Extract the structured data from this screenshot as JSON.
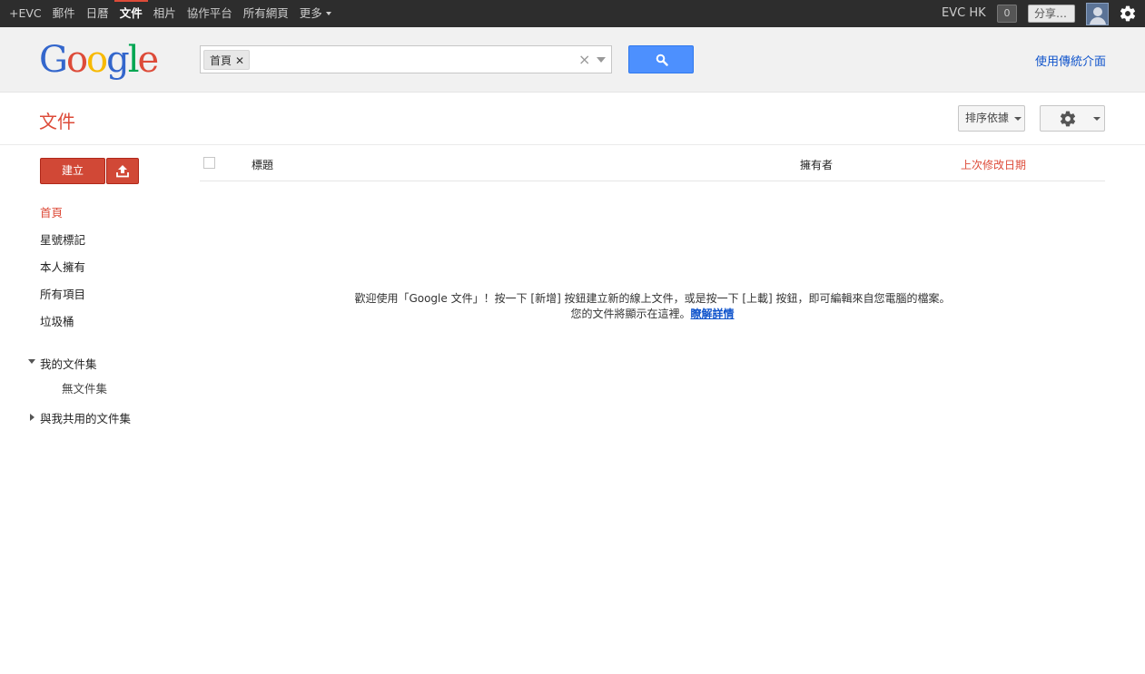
{
  "topbar": {
    "nav": [
      {
        "label": "+EVC",
        "active": false
      },
      {
        "label": "郵件",
        "active": false
      },
      {
        "label": "日曆",
        "active": false
      },
      {
        "label": "文件",
        "active": true
      },
      {
        "label": "相片",
        "active": false
      },
      {
        "label": "協作平台",
        "active": false
      },
      {
        "label": "所有網頁",
        "active": false
      },
      {
        "label": "更多",
        "active": false,
        "dropdown": true
      }
    ],
    "user_name": "EVC HK",
    "notification_count": "0",
    "share_label": "分享…"
  },
  "header": {
    "logo": [
      "G",
      "o",
      "o",
      "g",
      "l",
      "e"
    ],
    "logo_colors": [
      "#3366cc",
      "#dd4b39",
      "#f7b900",
      "#3366cc",
      "#00a652",
      "#dd4b39"
    ],
    "search_chip": "首頁",
    "search_clear": "×",
    "classic_link": "使用傳統介面"
  },
  "page": {
    "title": "文件",
    "sort_label": "排序依據"
  },
  "sidebar": {
    "create_label": "建立",
    "items": [
      {
        "label": "首頁",
        "active": true
      },
      {
        "label": "星號標記",
        "active": false
      },
      {
        "label": "本人擁有",
        "active": false
      },
      {
        "label": "所有項目",
        "active": false
      },
      {
        "label": "垃圾桶",
        "active": false
      }
    ],
    "my_collections": "我的文件集",
    "no_collections": "無文件集",
    "shared_collections": "與我共用的文件集"
  },
  "list": {
    "col_title": "標題",
    "col_owner": "擁有者",
    "col_date": "上次修改日期"
  },
  "empty": {
    "line1": "歡迎使用「Google 文件」！按一下 [新增] 按鈕建立新的線上文件，或是按一下 [上載] 按鈕，即可編輯來自您電腦的檔案。",
    "line2": "您的文件將顯示在這裡。",
    "learn_more": "瞭解詳情"
  },
  "colors": {
    "accent_red": "#dd4b39",
    "search_blue": "#4d90fe",
    "link_blue": "#1155cc"
  }
}
